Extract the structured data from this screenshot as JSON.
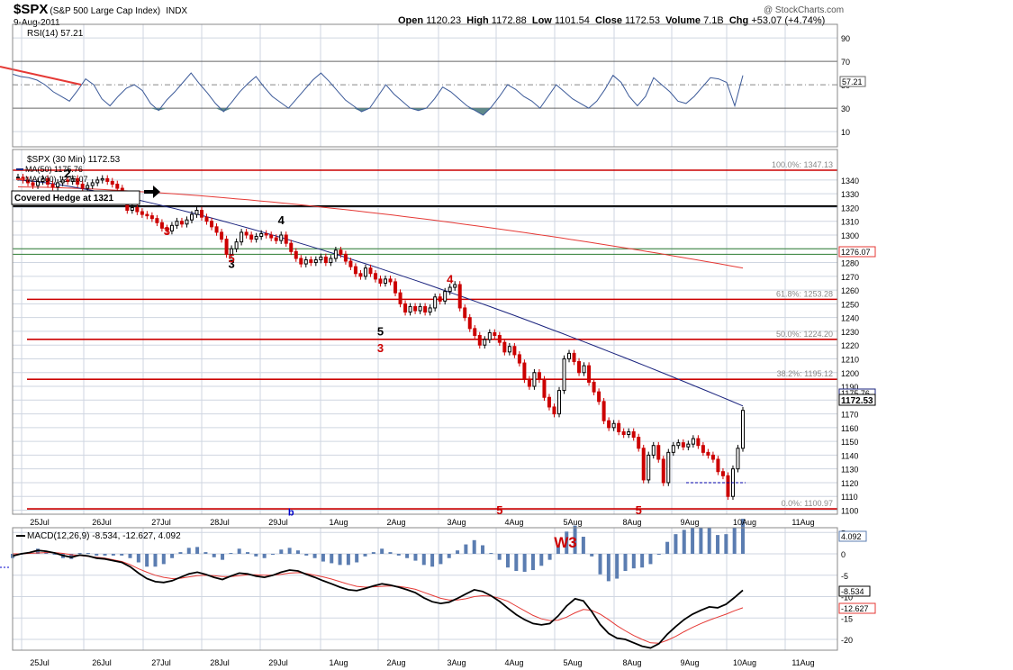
{
  "header": {
    "symbol": "$SPX",
    "name": "(S&P 500 Large Cap Index)",
    "exchange": "INDX",
    "date": "9-Aug-2011",
    "copyright": "@ StockCharts.com",
    "open_label": "Open",
    "open": "1120.23",
    "high_label": "High",
    "high": "1172.88",
    "low_label": "Low",
    "low": "1101.54",
    "close_label": "Close",
    "close": "1172.53",
    "volume_label": "Volume",
    "volume": "7.1B",
    "chg_label": "Chg",
    "chg": "+53.07 (+4.74%)"
  },
  "rsi": {
    "label": "RSI(14) 57.21",
    "value_badge": "57.21",
    "levels": [
      90,
      70,
      50,
      30,
      10
    ],
    "overbought": 70,
    "oversold": 30,
    "values": [
      59,
      57,
      56,
      54,
      50,
      44,
      40,
      36,
      45,
      55,
      50,
      38,
      32,
      40,
      47,
      50,
      45,
      34,
      28,
      37,
      44,
      52,
      60,
      51,
      43,
      34,
      27,
      35,
      44,
      51,
      57,
      48,
      40,
      35,
      30,
      38,
      46,
      54,
      60,
      53,
      45,
      37,
      32,
      27,
      30,
      40,
      50,
      42,
      36,
      30,
      28,
      30,
      38,
      48,
      44,
      38,
      32,
      28,
      24,
      31,
      40,
      50,
      46,
      40,
      36,
      30,
      40,
      50,
      44,
      38,
      34,
      30,
      36,
      46,
      58,
      52,
      40,
      32,
      40,
      56,
      50,
      44,
      36,
      34,
      40,
      48,
      56,
      55,
      52,
      32,
      58
    ]
  },
  "price": {
    "label": "$SPX (30 Min) 1172.53",
    "ma50_label": "MA(50) 1175.76",
    "ma200_label": "MA(200) 1276.07",
    "close_badge": "1172.53",
    "ma200_badge": "1276.07",
    "ma50_badge": "1175.76",
    "y_ticks": [
      1340,
      1330,
      1320,
      1310,
      1300,
      1290,
      1280,
      1270,
      1260,
      1250,
      1240,
      1230,
      1220,
      1210,
      1200,
      1190,
      1180,
      1170,
      1160,
      1150,
      1140,
      1130,
      1120,
      1110,
      1100
    ],
    "ylim": [
      1098,
      1352
    ],
    "fib_levels": [
      {
        "value": 1347.13,
        "label": "100.0%: 1347.13"
      },
      {
        "value": 1253.28,
        "label": "61.8%: 1253.28"
      },
      {
        "value": 1224.2,
        "label": "50.0%: 1224.20"
      },
      {
        "value": 1195.12,
        "label": "38.2%: 1195.12"
      },
      {
        "value": 1100.97,
        "label": "0.0%: 1100.97"
      }
    ],
    "hedge_line": 1321,
    "hedge_label": "Covered Hedge at 1321",
    "green_lines": [
      1290,
      1286
    ],
    "downtrend_line": [
      1344,
      1333
    ]
  },
  "chart_data": {
    "type": "candlestick",
    "interval": "30 Min",
    "x_labels": [
      "25Jul",
      "26Jul",
      "27Jul",
      "28Jul",
      "29Jul",
      "1Aug",
      "2Aug",
      "3Aug",
      "4Aug",
      "5Aug",
      "8Aug",
      "9Aug",
      "10Aug",
      "11Aug"
    ],
    "closes": [
      1342,
      1340,
      1338,
      1336,
      1339,
      1341,
      1337,
      1335,
      1338,
      1340,
      1339,
      1341,
      1337,
      1334,
      1336,
      1338,
      1340,
      1341,
      1339,
      1337,
      1334,
      1325,
      1318,
      1320,
      1317,
      1315,
      1314,
      1312,
      1309,
      1305,
      1303,
      1307,
      1310,
      1308,
      1311,
      1315,
      1318,
      1313,
      1310,
      1306,
      1302,
      1297,
      1286,
      1290,
      1295,
      1302,
      1300,
      1297,
      1299,
      1301,
      1300,
      1298,
      1296,
      1300,
      1294,
      1288,
      1283,
      1279,
      1282,
      1280,
      1282,
      1284,
      1280,
      1283,
      1289,
      1286,
      1281,
      1277,
      1272,
      1270,
      1276,
      1272,
      1268,
      1265,
      1268,
      1266,
      1258,
      1250,
      1244,
      1248,
      1245,
      1248,
      1244,
      1247,
      1255,
      1252,
      1259,
      1262,
      1264,
      1247,
      1240,
      1232,
      1227,
      1220,
      1224,
      1229,
      1227,
      1222,
      1215,
      1219,
      1213,
      1207,
      1195,
      1190,
      1200,
      1195,
      1182,
      1175,
      1170,
      1187,
      1210,
      1214,
      1208,
      1200,
      1205,
      1193,
      1186,
      1179,
      1165,
      1160,
      1163,
      1157,
      1155,
      1157,
      1153,
      1145,
      1122,
      1140,
      1147,
      1137,
      1120,
      1142,
      1147,
      1149,
      1146,
      1148,
      1152,
      1147,
      1142,
      1140,
      1137,
      1128,
      1125,
      1110,
      1130,
      1145,
      1172.53
    ],
    "ma50": {
      "start": 1340,
      "end": 1175.76
    },
    "ma200": {
      "start": 1335,
      "end": 1276.07
    },
    "annotations": [
      {
        "text": "2",
        "color": "#000000",
        "x_index": 10,
        "price": 1342
      },
      {
        "text": "3",
        "color": "#000000",
        "x_index": 43,
        "price": 1276
      },
      {
        "text": "5",
        "color": "#cc0000",
        "x_index": 43,
        "price": 1280
      },
      {
        "text": "3",
        "color": "#cc0000",
        "x_index": 30,
        "price": 1300
      },
      {
        "text": "4",
        "color": "#000000",
        "x_index": 53,
        "price": 1308
      },
      {
        "text": "4",
        "color": "#cc0000",
        "x_index": 87,
        "price": 1265
      },
      {
        "text": "5",
        "color": "#000000",
        "x_index": 73,
        "price": 1227
      },
      {
        "text": "3",
        "color": "#cc0000",
        "x_index": 73,
        "price": 1215
      },
      {
        "text": "5",
        "color": "#cc0000",
        "x_index": 97,
        "price": 1097
      },
      {
        "text": "5",
        "color": "#cc0000",
        "x_index": 125,
        "price": 1097
      },
      {
        "text": "b",
        "color": "#0000cc",
        "x_index": 55,
        "price": 1096
      }
    ]
  },
  "macd": {
    "label": "MACD(12,26,9) -8.534, -12.627, 4.092",
    "hist_badge": "4.092",
    "macd_badge": "-8.534",
    "signal_badge": "-12.627",
    "wave_label": "W3",
    "y_ticks": [
      5,
      0,
      -5,
      -10,
      -15,
      -20
    ],
    "ylim": [
      -23,
      7
    ],
    "macd": [
      -0.5,
      0,
      0.3,
      0.8,
      0.6,
      0.2,
      -0.4,
      -0.8,
      -0.3,
      -0.5,
      -1,
      -1.2,
      -1.6,
      -2,
      -3,
      -4.5,
      -5.8,
      -6.5,
      -6.7,
      -6.3,
      -5.5,
      -4.7,
      -4.3,
      -4.8,
      -5.5,
      -6,
      -5.2,
      -4.5,
      -4.7,
      -5.2,
      -5.5,
      -5,
      -4.3,
      -3.8,
      -4,
      -4.8,
      -5.5,
      -6.3,
      -7,
      -7.8,
      -8.4,
      -8.6,
      -8.1,
      -7.5,
      -7,
      -7.3,
      -7.8,
      -8.4,
      -9.1,
      -10.3,
      -11.2,
      -11.6,
      -11.3,
      -10.4,
      -9.4,
      -8.4,
      -8.8,
      -9.8,
      -11.1,
      -12.7,
      -14.2,
      -15.4,
      -16.3,
      -16.6,
      -16.3,
      -14.5,
      -12.2,
      -10.5,
      -11,
      -13.5,
      -16.5,
      -18.6,
      -19.7,
      -20,
      -20.8,
      -21.6,
      -22,
      -21,
      -18.8,
      -17,
      -15.4,
      -14.1,
      -13.2,
      -12.4,
      -12.6,
      -11.8,
      -10.2,
      -8.5
    ],
    "signal": [
      0,
      0,
      0.1,
      0.2,
      0.3,
      0.3,
      0.1,
      -0.2,
      -0.4,
      -0.6,
      -0.8,
      -1,
      -1.4,
      -1.8,
      -2.5,
      -3.5,
      -4.3,
      -5,
      -5.5,
      -5.8,
      -5.7,
      -5.4,
      -5.1,
      -5,
      -5.1,
      -5.3,
      -5.3,
      -5.1,
      -4.9,
      -4.9,
      -5,
      -5,
      -4.8,
      -4.5,
      -4.4,
      -4.6,
      -5,
      -5.4,
      -5.9,
      -6.5,
      -7.1,
      -7.6,
      -7.8,
      -7.7,
      -7.6,
      -7.5,
      -7.6,
      -7.9,
      -8.3,
      -9,
      -9.7,
      -10.4,
      -10.8,
      -10.8,
      -10.5,
      -10,
      -9.8,
      -9.9,
      -10.4,
      -11.1,
      -12.2,
      -13.3,
      -14.4,
      -15.2,
      -15.6,
      -15.5,
      -14.8,
      -13.8,
      -13,
      -13.2,
      -14.1,
      -15.4,
      -16.8,
      -18,
      -19.1,
      -20,
      -20.8,
      -20.9,
      -20.2,
      -19.3,
      -18.2,
      -17.2,
      -16.3,
      -15.5,
      -14.8,
      -14.1,
      -13.3,
      -12.6
    ]
  },
  "colors": {
    "grid": "#cfd6e1",
    "fib": "#cc0000",
    "ma50": "#1a237e",
    "ma200": "#e53935",
    "up": "#000000",
    "down": "#cc0000",
    "rsi_line": "#3b5998",
    "rsi_fill": "#5f8a8b",
    "hist": "#5b7db1",
    "green": "#2e7d32"
  }
}
